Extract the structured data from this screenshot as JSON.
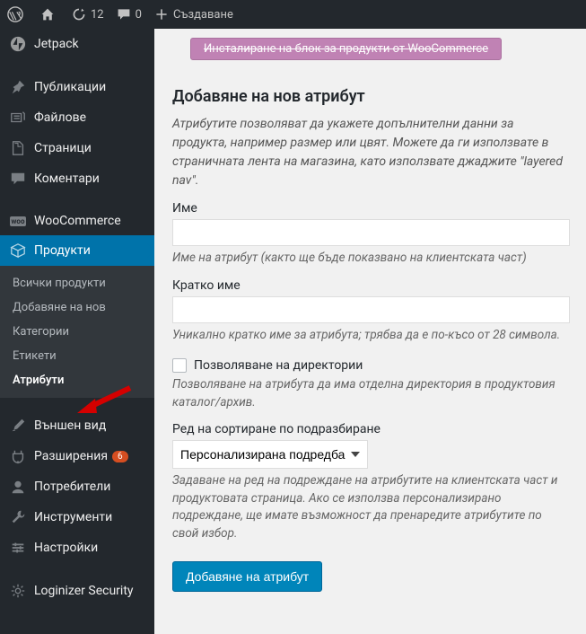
{
  "topbar": {
    "refresh_count": "12",
    "comments_count": "0",
    "create_label": "Създаване"
  },
  "menu": {
    "jetpack": "Jetpack",
    "posts": "Публикации",
    "media": "Файлове",
    "pages": "Страници",
    "comments": "Коментари",
    "woocommerce": "WooCommerce",
    "products": "Продукти",
    "sub_all": "Всички продукти",
    "sub_add": "Добавяне на нов",
    "sub_cat": "Категории",
    "sub_tags": "Етикети",
    "sub_attr": "Атрибути",
    "appearance": "Външен вид",
    "plugins": "Разширения",
    "plugins_badge": "6",
    "users": "Потребители",
    "tools": "Инструменти",
    "settings": "Настройки",
    "loginizer": "Loginizer Security"
  },
  "panel": {
    "install_banner": "Инсталиране на блок за продукти от WooCommerce",
    "title": "Добавяне на нов атрибут",
    "intro": "Атрибутите позволяват да укажете допълнителни данни за продукта, например размер или цвят. Можете да ги използвате в страничната лента на магазина, като използвате джаджите \"layered nav\".",
    "name_label": "Име",
    "name_hint": "Име на атрибут (както ще бъде показвано на клиентската част)",
    "slug_label": "Кратко име",
    "slug_hint": "Уникално кратко име за атрибута; трябва да е по-късо от 28 символа.",
    "archive_label": "Позволяване на директории",
    "archive_hint": "Позволяване на атрибута да има отделна директория в продуктовия каталог/архив.",
    "sort_label": "Ред на сортиране по подразбиране",
    "sort_option": "Персонализирана подредба",
    "sort_hint": "Задаване на ред на подреждане на атрибутите на клиентската част и продуктовата страница. Ако се използва персонализирано подреждане, ще имате възможност да пренаредите атрибутите по свой избор.",
    "submit": "Добавяне на атрибут"
  }
}
